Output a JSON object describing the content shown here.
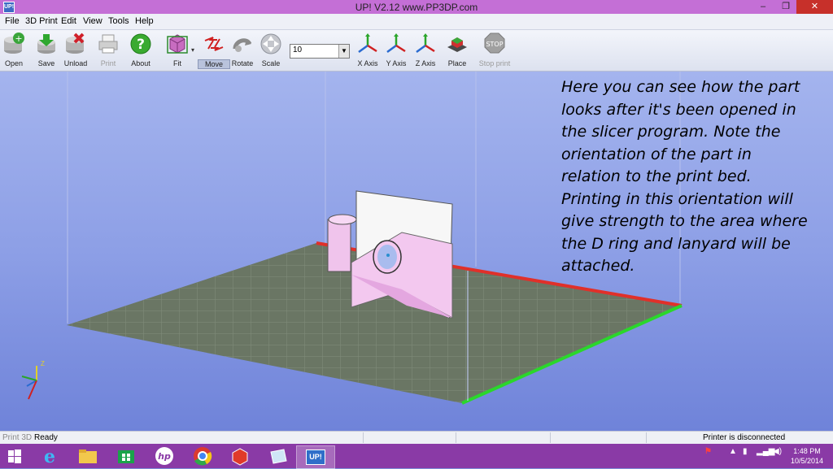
{
  "window": {
    "app_icon": "UP!",
    "title": "UP!  V2.12 www.PP3DP.com",
    "controls": [
      "–",
      "❐",
      "✕"
    ]
  },
  "menu": [
    "File",
    "3D Print",
    "Edit",
    "View",
    "Tools",
    "Help"
  ],
  "toolbar": {
    "open": "Open",
    "save": "Save",
    "unload": "Unload",
    "print": "Print",
    "about": "About",
    "fit": "Fit",
    "move": "Move",
    "rotate": "Rotate",
    "scale": "Scale",
    "amount_value": "10",
    "x_axis": "X Axis",
    "y_axis": "Y Axis",
    "z_axis": "Z Axis",
    "place": "Place",
    "stop_print": "Stop print",
    "stop_sign": "STOP"
  },
  "viewport": {
    "axis_z": "Z",
    "note_lines": [
      "Here you can see how the part",
      "looks after it's been opened in",
      "the slicer program.  Note the",
      "orientation of the part in",
      "relation to the print bed.",
      "Printing in this orientation will",
      "give strength to the area where",
      "the D ring and lanyard will be",
      "attached."
    ]
  },
  "status": {
    "mode": "Print 3D",
    "state": "Ready",
    "printer": "Printer is disconnected"
  },
  "taskbar": {
    "hp": "hp",
    "up": "UP!",
    "time": "1:48 PM",
    "date": "10/5/2014"
  },
  "colors": {
    "title_bar": "#c46fd6",
    "taskbar": "#8a3aa6",
    "bed": "#6a7664",
    "part": "#f3c8ef",
    "x_edge": "#2bd62b",
    "y_edge": "#e0302a"
  }
}
